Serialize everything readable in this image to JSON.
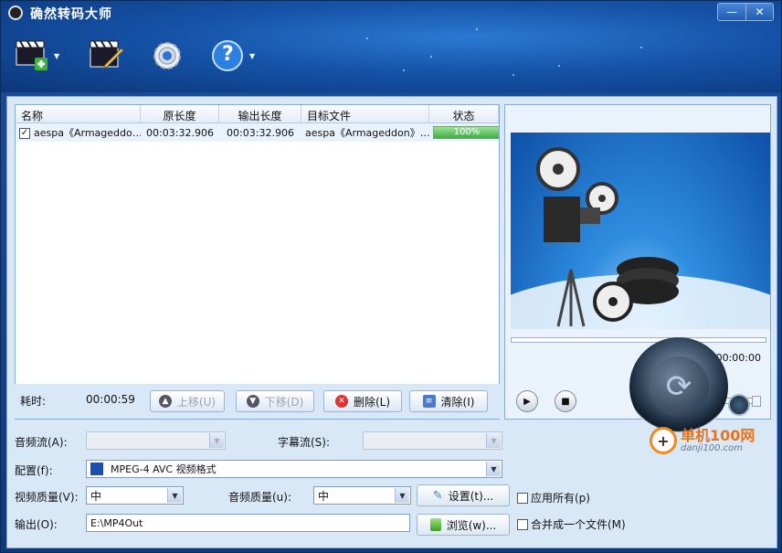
{
  "window": {
    "title": "确然转码大师",
    "minimize": "—",
    "close": "✕"
  },
  "toolbar": {
    "add_icon": "film-add-icon",
    "edit_icon": "film-edit-icon",
    "settings_icon": "gear-icon",
    "help_icon": "help-icon",
    "help_glyph": "?"
  },
  "file_list": {
    "columns": [
      "名称",
      "原长度",
      "输出长度",
      "目标文件",
      "状态"
    ],
    "rows": [
      {
        "checked": true,
        "name": "aespa《Armageddo…",
        "source_length": "00:03:32.906",
        "output_length": "00:03:32.906",
        "target": "aespa《Armageddon》…",
        "status": "100%",
        "progress": 100
      }
    ]
  },
  "footer": {
    "elapsed_label": "耗时:",
    "elapsed_value": "00:00:59",
    "move_up": "上移(U)",
    "move_down": "下移(D)",
    "delete": "删除(L)",
    "clear": "清除(I)"
  },
  "preview": {
    "timecode": "00:00:00/00:00:00",
    "volume": 1.0
  },
  "settings": {
    "audio_stream_label": "音频流(A):",
    "subtitle_stream_label": "字幕流(S):",
    "profile_label": "配置(f):",
    "profile_value": "MPEG-4 AVC 视频格式",
    "video_quality_label": "视频质量(V):",
    "video_quality_value": "中",
    "audio_quality_label": "音频质量(u):",
    "audio_quality_value": "中",
    "settings_button": "设置(t)...",
    "apply_all": "应用所有(p)",
    "output_label": "输出(O):",
    "output_value": "E:\\MP4Out",
    "browse_button": "浏览(w)...",
    "merge_one": "合并成一个文件(M)"
  },
  "watermark": {
    "brand": "单机100网",
    "url": "danji100.com",
    "logo_glyph": "+"
  }
}
